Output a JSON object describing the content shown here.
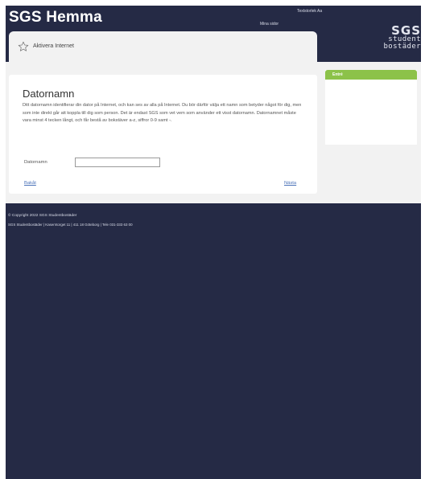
{
  "header": {
    "site_title": "SGS Hemma",
    "textsize_label": "Textstorlek Aa",
    "my_pages_label": "Mina sidor",
    "logo": {
      "mark": "SGS",
      "line1": "student",
      "line2": "bostäder"
    }
  },
  "breadcrumb": {
    "icon": "star-outline-icon",
    "label": "Aktivera Internet"
  },
  "main": {
    "heading": "Datornamn",
    "intro": "Ditt datornamn identifierar din dator på Internet, och kan ses av alla på Internet. Du bör därför välja ett namn som betyder något för dig, men som inte direkt går att koppla till dig som person. Det är endast SGS som vet vem som använder ett visst datornamn. Datornamnet måste vara minst 4 tecken långt, och får bestå av bokstäver a-z, siffror 0-9 samt -.",
    "field": {
      "label": "Datornamn",
      "value": "",
      "placeholder": ""
    },
    "back_label": "Bakåt",
    "next_label": "Nästa"
  },
  "sidebar": {
    "title": "Entré"
  },
  "footer": {
    "copyright": "© Copyright 2022 SGS Studentbostäder",
    "address": "SGS Studentbostäder  |  Kaserntorget 11  |  411 18 Göteborg  |  Tele 031-333 63 00"
  },
  "colors": {
    "navy": "#252a45",
    "panel_grey": "#f2f2f2",
    "accent_green": "#8cc249",
    "link_blue": "#4a72b8"
  }
}
